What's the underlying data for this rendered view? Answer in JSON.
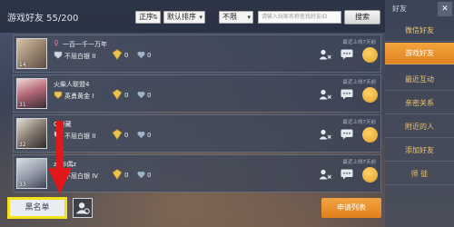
{
  "header": {
    "title": "游戏好友 55/200",
    "sort_order": "正序",
    "sort_by": "默认排序",
    "filter": "不限",
    "search_placeholder": "请输入玩家名称查找好友ID",
    "search_label": "搜索"
  },
  "friends": [
    {
      "name": "一百一千一万年",
      "gender": "♀",
      "level": "14",
      "rank": "不屈白银 II",
      "gems": "0",
      "hearts": "0",
      "last_online": "最近上线7天前"
    },
    {
      "name": "火柴人联盟4",
      "gender": "",
      "level": "31",
      "rank": "英勇黄金 I",
      "gems": "0",
      "hearts": "0",
      "last_online": "最近上线7天前"
    },
    {
      "name": "Q埋藏",
      "gender": "",
      "level": "32",
      "rank": "不屈白银 II",
      "gems": "0",
      "hearts": "0",
      "last_online": "最近上线7天前"
    },
    {
      "name": "zz布偶z",
      "gender": "",
      "level": "33",
      "rank": "不屈白银 IV",
      "gems": "0",
      "hearts": "0",
      "last_online": "最近上线7天前"
    }
  ],
  "bottom": {
    "blacklist_label": "黑名单",
    "apply_label": "申请列表"
  },
  "sidebar": {
    "title": "好友",
    "close_label": "✕",
    "items": [
      {
        "label": "微信好友"
      },
      {
        "label": "游戏好友"
      },
      {
        "label": "最近互动"
      },
      {
        "label": "亲密关系"
      },
      {
        "label": "附近的人"
      },
      {
        "label": "添加好友"
      },
      {
        "label": "师 徒"
      }
    ]
  },
  "colors": {
    "accent": "#e8922c",
    "highlight_frame": "#f2e21a",
    "arrow": "#e0181a",
    "sidebar_text": "#f4c56a"
  }
}
